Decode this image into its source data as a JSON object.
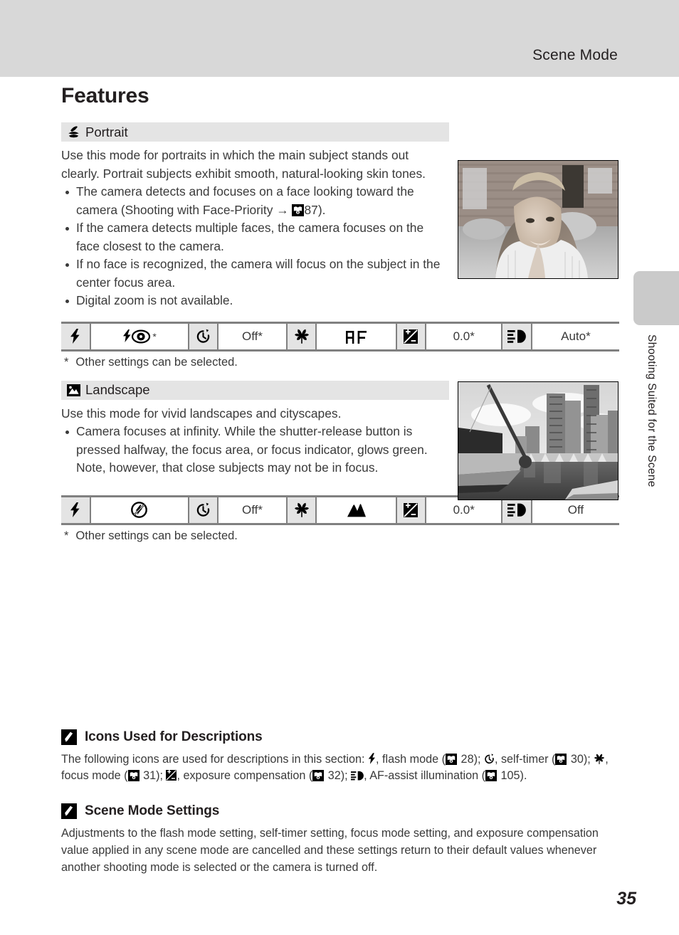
{
  "header": {
    "title": "Scene Mode"
  },
  "side_tab": {
    "label": "Shooting Suited for the Scene"
  },
  "page_title": "Features",
  "page_number": "35",
  "modes": [
    {
      "icon": "portrait-icon",
      "name": "Portrait",
      "intro": "Use this mode for portraits in which the main subject stands out clearly. Portrait subjects exhibit smooth, natural-looking skin tones.",
      "bullets": [
        {
          "pre": "The camera detects and focuses on a face looking toward the camera (Shooting with Face-Priority → ",
          "ref": "87",
          "post": ")."
        },
        {
          "pre": "If the camera detects multiple faces, the camera focuses on the face closest to the camera.",
          "ref": "",
          "post": ""
        },
        {
          "pre": "If no face is recognized, the camera will focus on the subject in the center focus area.",
          "ref": "",
          "post": ""
        },
        {
          "pre": "Digital zoom is not available.",
          "ref": "",
          "post": ""
        }
      ],
      "photo_alt": "portrait-sample-photo",
      "settings": [
        {
          "icon": "flash-mode-icon",
          "value": "",
          "value_icon": "flash-red-eye-icon",
          "star": "*"
        },
        {
          "icon": "self-timer-icon",
          "value": "Off*",
          "value_icon": "",
          "star": ""
        },
        {
          "icon": "focus-mode-icon",
          "value": "",
          "value_icon": "af-icon",
          "star": ""
        },
        {
          "icon": "exposure-compensation-icon",
          "value": "0.0*",
          "value_icon": "",
          "star": ""
        },
        {
          "icon": "af-assist-icon",
          "value": "Auto*",
          "value_icon": "",
          "star": ""
        }
      ],
      "footnote_star": "*",
      "footnote": "Other settings can be selected."
    },
    {
      "icon": "landscape-icon",
      "name": "Landscape",
      "intro": "Use this mode for vivid landscapes and cityscapes.",
      "bullets": [
        {
          "pre": "Camera focuses at infinity. While the shutter-release button is pressed halfway, the focus area, or focus indicator, glows green. Note, however, that close subjects may not be in focus.",
          "ref": "",
          "post": ""
        }
      ],
      "photo_alt": "landscape-sample-photo",
      "settings": [
        {
          "icon": "flash-mode-icon",
          "value": "",
          "value_icon": "flash-off-icon",
          "star": ""
        },
        {
          "icon": "self-timer-icon",
          "value": "Off*",
          "value_icon": "",
          "star": ""
        },
        {
          "icon": "focus-mode-icon",
          "value": "",
          "value_icon": "infinity-focus-icon",
          "star": ""
        },
        {
          "icon": "exposure-compensation-icon",
          "value": "0.0*",
          "value_icon": "",
          "star": ""
        },
        {
          "icon": "af-assist-icon",
          "value": "Off",
          "value_icon": "",
          "star": ""
        }
      ],
      "footnote_star": "*",
      "footnote": "Other settings can be selected."
    }
  ],
  "notes": [
    {
      "icon": "pencil-note-icon",
      "title": "Icons Used for Descriptions",
      "segments": [
        {
          "t": "The following icons are used for descriptions in this section: "
        },
        {
          "icon": "flash-mode-icon"
        },
        {
          "t": ", flash mode ("
        },
        {
          "icon": "book-icon"
        },
        {
          "t": " 28); "
        },
        {
          "icon": "self-timer-icon"
        },
        {
          "t": ", self-timer ("
        },
        {
          "icon": "book-icon"
        },
        {
          "t": " 30); "
        },
        {
          "icon": "focus-mode-icon"
        },
        {
          "t": ", focus mode ("
        },
        {
          "icon": "book-icon"
        },
        {
          "t": " 31); "
        },
        {
          "icon": "exposure-compensation-icon"
        },
        {
          "t": ", exposure compensation ("
        },
        {
          "icon": "book-icon"
        },
        {
          "t": " 32); "
        },
        {
          "icon": "af-assist-icon"
        },
        {
          "t": ", AF-assist illumination ("
        },
        {
          "icon": "book-icon"
        },
        {
          "t": " 105)."
        }
      ]
    },
    {
      "icon": "pencil-note-icon",
      "title": "Scene Mode Settings",
      "segments": [
        {
          "t": "Adjustments to the flash mode setting, self-timer setting, focus mode setting, and exposure compensation value applied in any scene mode are cancelled and these settings return to their default values whenever another shooting mode is selected or the camera is turned off."
        }
      ]
    }
  ],
  "colors": {
    "header_bg": "#d8d8d8",
    "mode_head_bg": "#e4e4e4",
    "table_rule": "#808080",
    "tab_bg": "#cacaca",
    "text": "#231f20"
  }
}
